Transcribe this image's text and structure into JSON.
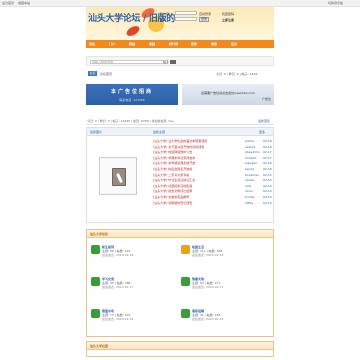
{
  "topbar": {
    "left": "设为首页",
    "middle": "收藏本站",
    "right": "切换到窄版"
  },
  "header": {
    "logo": "汕头大学论坛 / 旧版的",
    "colors": {
      "brand": "#2a62b0",
      "accent": "#f08a1e"
    }
  },
  "login": {
    "username_label": "用户名",
    "username_value": "",
    "password_label": "密码",
    "password_value": "",
    "auto_label": "自动登录",
    "find_password": "找回密码",
    "login_button": "登录",
    "register": "立即注册"
  },
  "nav": {
    "items": [
      "论坛",
      "门户",
      "群组",
      "家园",
      "排行榜",
      "帮助",
      "搜索",
      "音乐"
    ]
  },
  "search": {
    "placeholder": "请输入搜索内容",
    "scope": "帖子"
  },
  "crumb": {
    "home": "论坛",
    "current": "论坛首页",
    "right": "今日: 0 | 昨日: 0 | 帖子: 1234"
  },
  "ads": {
    "left": {
      "main": "本广告位招商",
      "sub": "联系电话: 123456"
    },
    "right": {
      "main": "您需要广告位请点击此处www.bbs.com",
      "sub": "广告位"
    }
  },
  "info": {
    "stats": "今日: 0 | 昨日: 0 | 帖子: 12345 | 会员: 6789 | 欢迎新会员: hey",
    "right": "最新回复"
  },
  "latest": {
    "tab1": "最新图片",
    "tab2": "最新主题",
    "tab3": "最新回复",
    "tab4": "热门帖子",
    "right": "更多",
    "rows": [
      {
        "title": "[汕头大学] 汕大学生会换届选举结果通知",
        "user": "admin",
        "date": "02-18"
      },
      {
        "title": "[汕头大学] 关于图书馆开放时间的通知",
        "user": "user01",
        "date": "02-18"
      },
      {
        "title": "[汕头大学] 校园网络维护公告",
        "user": "bbsadmin",
        "date": "02-17"
      },
      {
        "title": "[汕头大学] 学期末考试安排发布",
        "user": "student",
        "date": "02-17"
      },
      {
        "title": "[汕头大学] 新学期选课系统开放",
        "user": "wanglei",
        "date": "02-16"
      },
      {
        "title": "[汕头大学] 校运会报名开始啦",
        "user": "sports",
        "date": "02-16"
      },
      {
        "title": "[汕头大学] 二手书交易专帖",
        "user": "bookman",
        "date": "02-15"
      },
      {
        "title": "[汕头大学] 毕业生就业信息汇总",
        "user": "career",
        "date": "02-15"
      },
      {
        "title": "[汕头大学] 社团招新活动集锦",
        "user": "club",
        "date": "02-14"
      },
      {
        "title": "[汕头大学] 宿舍文明评比结果",
        "user": "dorm",
        "date": "02-14"
      },
      {
        "title": "[汕头大学] 食堂新菜品推荐",
        "user": "foodie",
        "date": "02-13"
      },
      {
        "title": "[汕头大学] 寒假留校登记通知",
        "user": "office",
        "date": "02-13"
      }
    ]
  },
  "section1": {
    "title": "汕头大学论坛",
    "forums": [
      {
        "name": "新生报到",
        "stat": "主题: 86 | 帖数: 429",
        "last": "最后发表: 2024-02-18"
      },
      {
        "name": "校园生活",
        "stat": "主题: 112 | 帖数: 636",
        "last": "最后发表: 2024-02-18"
      },
      {
        "name": "学习交流",
        "stat": "主题: 95 | 帖数: 388",
        "last": "最后发表: 2024-02-17"
      },
      {
        "name": "情感天地",
        "stat": "主题: 64 | 帖数: 271",
        "last": "最后发表: 2024-02-17"
      },
      {
        "name": "跳蚤市场",
        "stat": "主题: 73 | 帖数: 320",
        "last": "最后发表: 2024-02-16"
      },
      {
        "name": "兼职招聘",
        "stat": "主题: 41 | 帖数: 158",
        "last": "最后发表: 2024-02-16"
      }
    ]
  },
  "section2": {
    "title": "汕头大学社团"
  }
}
